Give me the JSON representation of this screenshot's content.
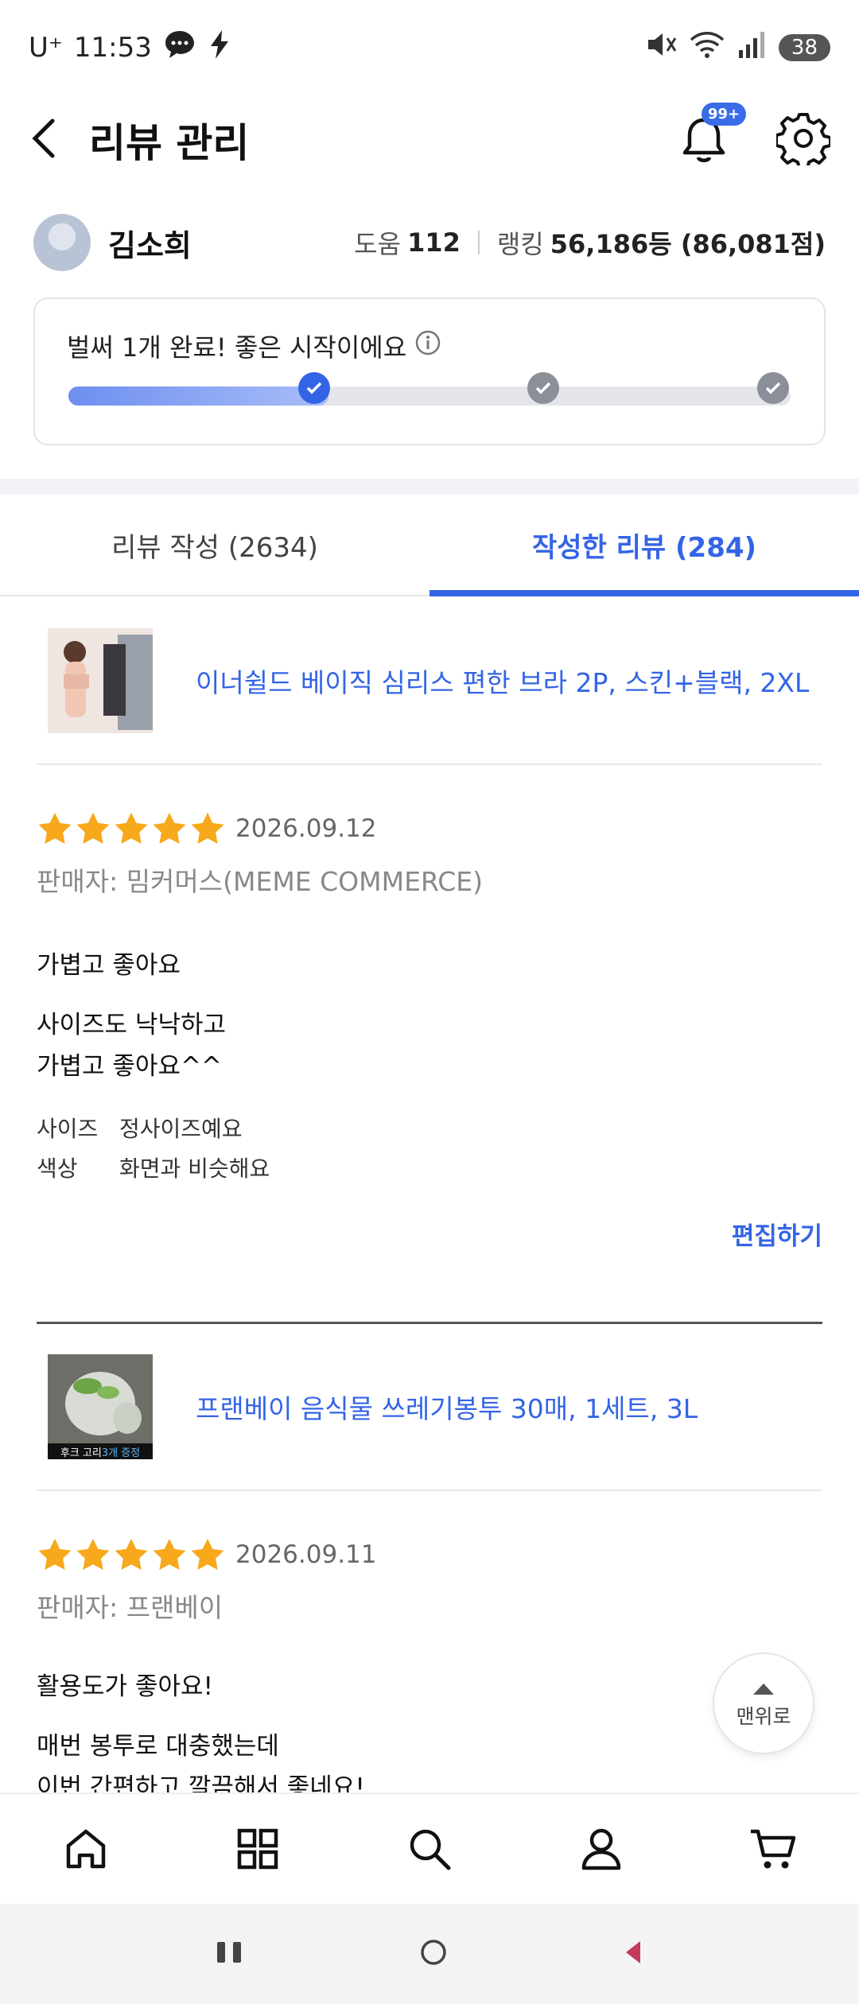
{
  "status_bar": {
    "carrier": "U⁺",
    "time": "11:53",
    "battery": "38",
    "icons": [
      "chat-bubble-icon",
      "bolt-icon",
      "mute-icon",
      "wifi-icon",
      "signal-icon"
    ]
  },
  "header": {
    "title": "리뷰 관리",
    "notification_badge": "99+",
    "icons": [
      "back-arrow-icon",
      "bell-icon",
      "gear-icon"
    ]
  },
  "profile": {
    "name": "김소희",
    "help_label": "도움",
    "help_value": "112",
    "ranking_label": "랭킹",
    "ranking_value": "56,186등 (86,081점)"
  },
  "progress": {
    "message": "벌써 1개 완료! 좋은 시작이에요",
    "fill_fraction": 0.36,
    "steps_completed": 1,
    "steps_total": 3
  },
  "tabs": [
    {
      "label": "리뷰 작성 (2634)",
      "active": false
    },
    {
      "label": "작성한 리뷰 (284)",
      "active": true
    }
  ],
  "reviews": [
    {
      "product": "이너쉴드 베이직 심리스 편한 브라 2P, 스킨+블랙, 2XL",
      "rating": 5,
      "date": "2026.09.12",
      "seller": "판매자: 밈커머스(MEME COMMERCE)",
      "title": "가볍고 좋아요",
      "body_line1": "사이즈도 낙낙하고",
      "body_line2": "가볍고 좋아요^^",
      "attr_size_label": "사이즈",
      "attr_size_value": "정사이즈예요",
      "attr_color_label": "색상",
      "attr_color_value": "화면과 비슷해요",
      "edit_label": "편집하기"
    },
    {
      "product": "프랜베이 음식물 쓰레기봉투 30매, 1세트, 3L",
      "thumb_caption_a": "후크 고리 ",
      "thumb_caption_b": "3개 증정",
      "rating": 5,
      "date": "2026.09.11",
      "seller": "판매자: 프랜베이",
      "title": "활용도가 좋아요!",
      "body_line1": "매번 봉투로 대충했는데",
      "body_line2": "이번 간편하고 깔끔해서 좋네요!"
    }
  ],
  "to_top_label": "맨위로",
  "bottom_nav": [
    "home-icon",
    "grid-icon",
    "search-icon",
    "user-icon",
    "cart-icon"
  ],
  "colors": {
    "accent": "#3464e6",
    "star": "#f7a81b",
    "muted": "#888888"
  }
}
